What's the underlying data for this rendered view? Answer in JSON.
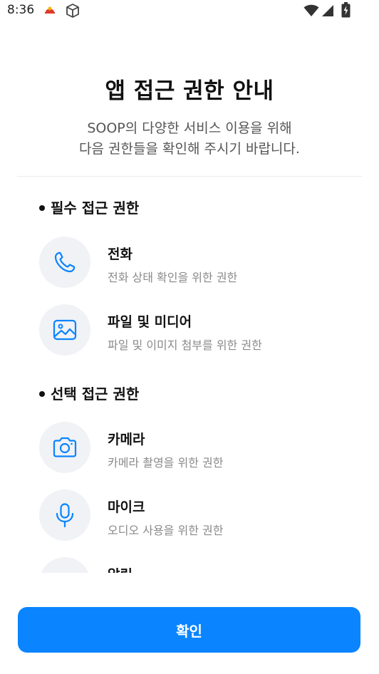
{
  "status_bar": {
    "time": "8:36",
    "icons": [
      "app-notification-icon",
      "box-icon",
      "wifi-icon",
      "signal-icon",
      "battery-icon"
    ]
  },
  "header": {
    "title": "앱 접근 권한 안내",
    "subtitle_line1": "SOOP의 다양한 서비스 이용을 위해",
    "subtitle_line2": "다음 권한들을 확인해 주시기 바랍니다."
  },
  "sections": [
    {
      "heading": "필수 접근 권한",
      "items": [
        {
          "title": "전화",
          "desc": "전화 상태 확인을 위한 권한",
          "icon": "phone-icon"
        },
        {
          "title": "파일 및 미디어",
          "desc": "파일 및 이미지 첨부를 위한 권한",
          "icon": "image-icon"
        }
      ]
    },
    {
      "heading": "선택 접근 권한",
      "items": [
        {
          "title": "카메라",
          "desc": "카메라 촬영을 위한 권한",
          "icon": "camera-icon"
        },
        {
          "title": "마이크",
          "desc": "오디오 사용을 위한 권한",
          "icon": "microphone-icon"
        },
        {
          "title": "알림",
          "desc": "",
          "icon": "notification-icon"
        }
      ]
    }
  ],
  "confirm_button": {
    "label": "확인"
  },
  "colors": {
    "accent": "#0a84ff",
    "icon_bg": "#f0f2f5",
    "muted_text": "#8a8a8a"
  }
}
